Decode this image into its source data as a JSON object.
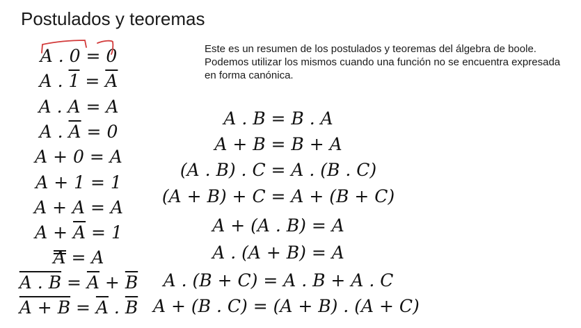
{
  "slide": {
    "title": "Postulados y teoremas",
    "description": "Este es un resumen de los postulados y teoremas del álgebra de boole. Podemos utilizar los mismos cuando una función no se encuentra expresada en forma canónica."
  },
  "left_equations": [
    "A.0=0",
    "A.1=A",
    "A.A=A",
    "A.Ā=0",
    "A+0=A",
    "A+1=1",
    "A+A=A",
    "A+Ā=1",
    "A̿=A",
    "(A.B)‾=Ā+B̄",
    "(A+B)‾=Ā.B̄"
  ],
  "right_equations": [
    "A.B=B.A",
    "A+B=B+A",
    "(A.B).C=A.(B.C)",
    "(A+B)+C=A+(B+C)",
    "A+(A.B)=A",
    "A.(A+B)=A",
    "A.(B+C)=A.B+A.C",
    "A+(B.C)=(A+B).(A+C)"
  ],
  "annotation_color": "#d23a3a"
}
